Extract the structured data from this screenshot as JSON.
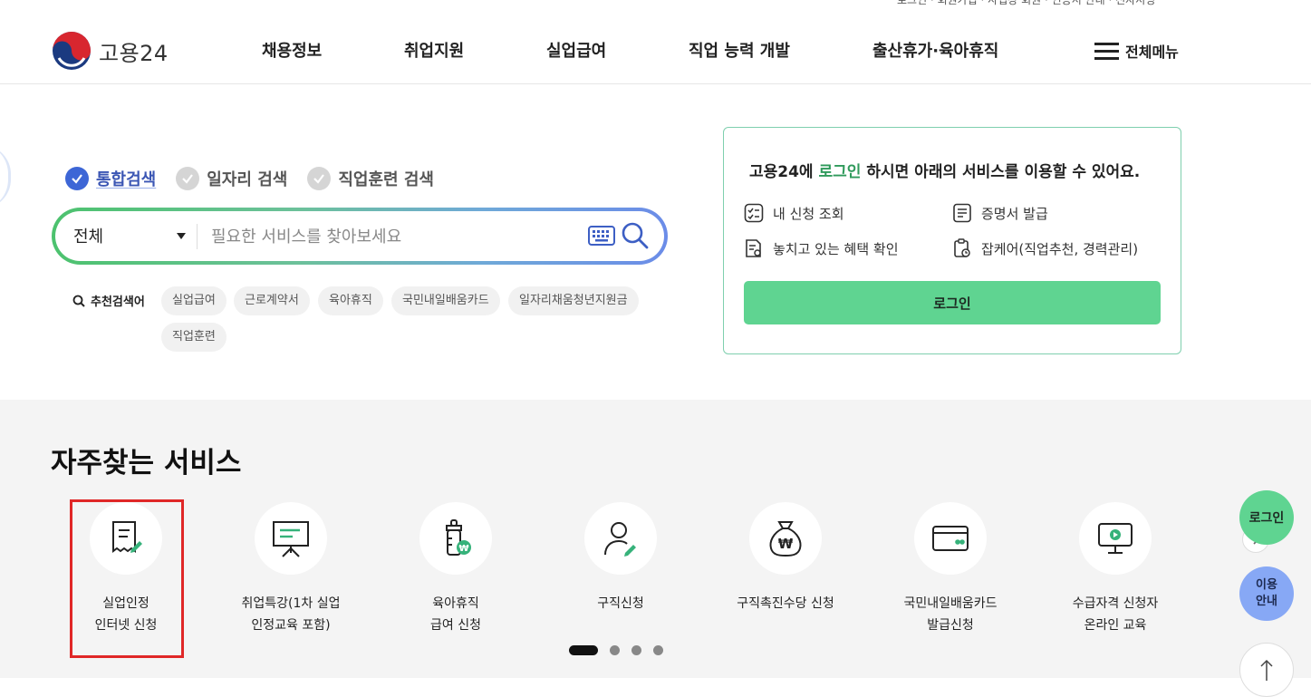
{
  "header": {
    "logo_text": "고용24",
    "util_text": "로그인 · 회원가입 · 사업장 회원 · 인증서 안내 · 전자서명",
    "nav": [
      "채용정보",
      "취업지원",
      "실업급여",
      "직업 능력 개발",
      "출산휴가·육아휴직"
    ],
    "all_menu": "전체메뉴"
  },
  "search": {
    "tabs": [
      {
        "label": "통합검색",
        "active": true
      },
      {
        "label": "일자리 검색",
        "active": false
      },
      {
        "label": "직업훈련 검색",
        "active": false
      }
    ],
    "category": "전체",
    "placeholder": "필요한 서비스를 찾아보세요",
    "recommend_label": "추천검색어",
    "keywords": [
      "실업급여",
      "근로계약서",
      "육아휴직",
      "국민내일배움카드",
      "일자리채움청년지원금",
      "직업훈련"
    ]
  },
  "login_box": {
    "msg_prefix": "고용24에 ",
    "msg_highlight": "로그인",
    "msg_suffix": " 하시면 아래의 서비스를 이용할 수 있어요.",
    "services": [
      "내 신청 조회",
      "증명서 발급",
      "놓치고 있는 혜택 확인",
      "잡케어(직업추천, 경력관리)"
    ],
    "button": "로그인"
  },
  "frequent": {
    "title": "자주찾는 서비스",
    "items": [
      {
        "line1": "실업인정",
        "line2": "인터넷 신청",
        "icon": "certificate-edit-icon"
      },
      {
        "line1": "취업특강(1차 실업",
        "line2": "인정교육 포함)",
        "icon": "presentation-board-icon"
      },
      {
        "line1": "육아휴직",
        "line2": "급여 신청",
        "icon": "baby-bottle-won-icon"
      },
      {
        "line1": "구직신청",
        "line2": "",
        "icon": "person-edit-icon"
      },
      {
        "line1": "구직촉진수당 신청",
        "line2": "",
        "icon": "money-bag-icon"
      },
      {
        "line1": "국민내일배움카드",
        "line2": "발급신청",
        "icon": "card-icon"
      },
      {
        "line1": "수급자격 신청자",
        "line2": "온라인 교육",
        "icon": "monitor-play-icon"
      }
    ],
    "pages": 4,
    "current_page": 1
  },
  "floating": {
    "login": "로그인",
    "guide_line1": "이용",
    "guide_line2": "안내"
  },
  "colors": {
    "accent_green": "#5fd491",
    "accent_blue": "#3d66d6",
    "highlight_red": "#e02727"
  }
}
